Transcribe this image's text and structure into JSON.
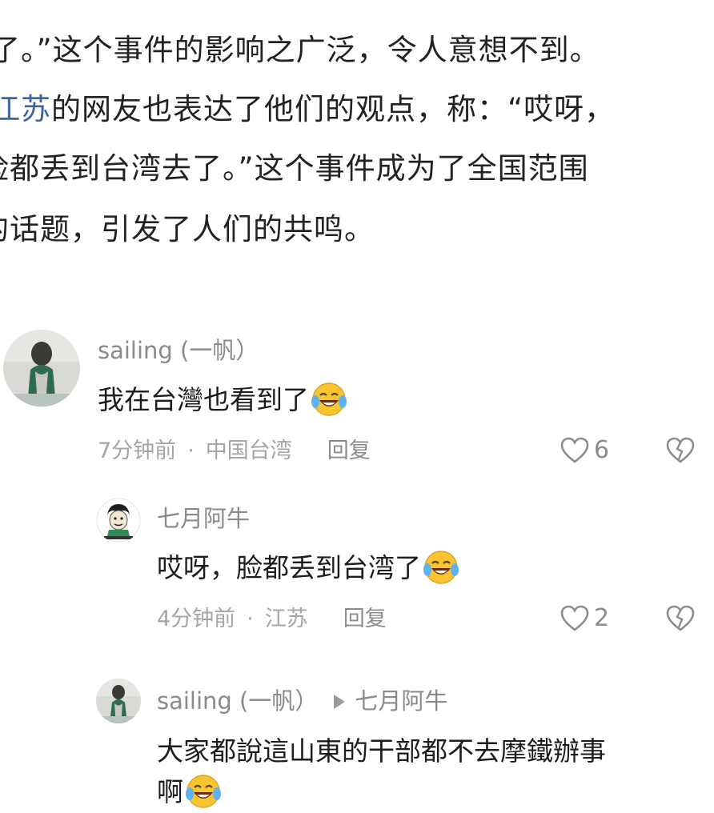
{
  "article": {
    "line1": "了。”这个事件的影响之广泛，令人意想不到。",
    "line2_link": "江苏",
    "line2_rest": "的网友也表达了他们的观点，称：“哎呀，",
    "line3": "脸都丢到台湾去了。”这个事件成为了全国范围",
    "line4": "的话题，引发了人们的共鸣。"
  },
  "comments": [
    {
      "user": "sailing (一帆）",
      "text": "我在台灣也看到了",
      "emoji": "laughing-tears-emoji",
      "time": "7分钟前",
      "sep": "·",
      "location": "中国台湾",
      "reply_label": "回复",
      "likes": "6"
    },
    {
      "user": "七月阿牛",
      "text": "哎呀，脸都丢到台湾了",
      "emoji": "laughing-tears-emoji",
      "time": "4分钟前",
      "sep": "·",
      "location": "江苏",
      "reply_label": "回复",
      "likes": "2"
    },
    {
      "user": "sailing (一帆）",
      "reply_to": "七月阿牛",
      "text_line1": "大家都說這山東的干部都不去摩鐵辦事",
      "text_line2": "啊",
      "emoji": "laughing-tears-emoji"
    }
  ],
  "icons": {
    "like": "heart-outline-icon",
    "dislike": "broken-heart-icon",
    "reply_arrow": "triangle-right-icon"
  },
  "colors": {
    "link": "#3c63a8",
    "meta": "#a5a5a5",
    "text": "#1c1c1c",
    "emoji_face": "#f7c531"
  }
}
